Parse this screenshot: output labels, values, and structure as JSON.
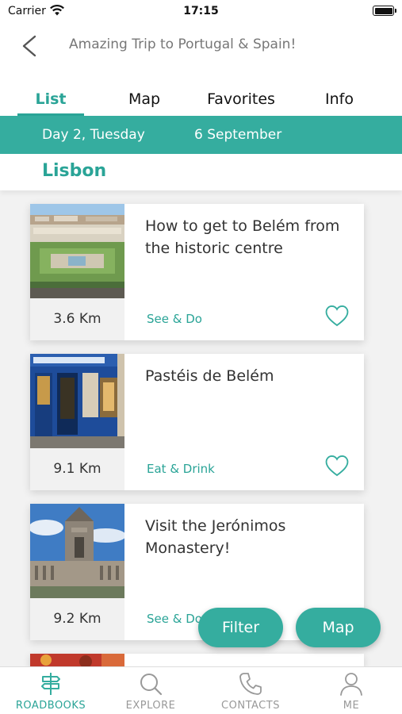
{
  "status_bar": {
    "carrier": "Carrier",
    "time": "17:15"
  },
  "nav": {
    "title": "Amazing Trip to Portugal & Spain!"
  },
  "tabs": [
    {
      "label": "List",
      "active": true
    },
    {
      "label": "Map"
    },
    {
      "label": "Favorites"
    },
    {
      "label": "Info"
    }
  ],
  "day": {
    "weekday": "Day 2, Tuesday",
    "date": "6 September"
  },
  "city": "Lisbon",
  "cards": [
    {
      "title": "How to get to Belém from the historic centre",
      "distance": "3.6 Km",
      "category": "See & Do",
      "photo": "aerial-belem-photo"
    },
    {
      "title": "Pastéis de Belém",
      "distance": "9.1 Km",
      "category": "Eat & Drink",
      "photo": "pasteis-shopfront-photo"
    },
    {
      "title": "Visit the Jerónimos Monastery!",
      "distance": "9.2 Km",
      "category": "See & Do",
      "photo": "monastery-photo"
    }
  ],
  "fab": {
    "filter": "Filter",
    "map": "Map"
  },
  "bottom_nav": [
    {
      "label": "ROADBOOKS",
      "icon": "signpost-icon",
      "active": true
    },
    {
      "label": "EXPLORE",
      "icon": "search-icon"
    },
    {
      "label": "CONTACTS",
      "icon": "phone-icon"
    },
    {
      "label": "ME",
      "icon": "person-icon"
    }
  ],
  "colors": {
    "accent": "#35ad9f",
    "accent_text": "#2aa497",
    "muted": "#999999"
  }
}
